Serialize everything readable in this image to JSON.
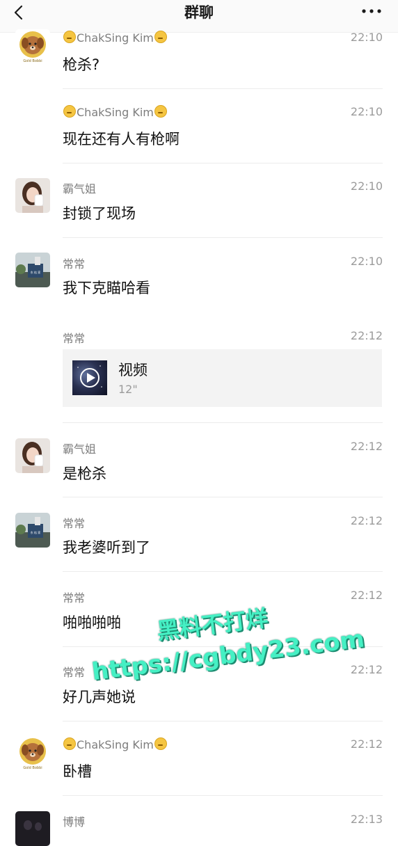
{
  "header": {
    "title": "群聊"
  },
  "messages": [
    {
      "sender": "ChakSing Kim",
      "time": "22:10",
      "text": "枪杀?"
    },
    {
      "sender": "ChakSing Kim",
      "time": "22:10",
      "text": "现在还有人有枪啊"
    },
    {
      "sender": "霸气姐",
      "time": "22:10",
      "text": "封锁了现场"
    },
    {
      "sender": "常常",
      "time": "22:10",
      "text": "我下克瞄哈看"
    },
    {
      "sender": "常常",
      "time": "22:12",
      "video": {
        "title": "视频",
        "duration": "12\""
      }
    },
    {
      "sender": "霸气姐",
      "time": "22:12",
      "text": "是枪杀"
    },
    {
      "sender": "常常",
      "time": "22:12",
      "text": "我老婆听到了"
    },
    {
      "sender": "常常",
      "time": "22:12",
      "text": "啪啪啪啪"
    },
    {
      "sender": "常常",
      "time": "22:12",
      "text": "好几声她说"
    },
    {
      "sender": "ChakSing Kim",
      "time": "22:12",
      "text": "卧槽"
    },
    {
      "sender": "博博",
      "time": "22:13",
      "text": ""
    }
  ],
  "avatar_labels": {
    "goldbobbi": "Gold Bobbi",
    "changchang_sign": "东 桔 家"
  },
  "watermark": {
    "line1": "黑料不打烊",
    "line2": "https://cgbdy23.com"
  },
  "icons": {
    "back": "chevron-left-icon",
    "more": "more-dots-icon",
    "play": "play-icon",
    "emoji": "grin-emoji-icon"
  }
}
